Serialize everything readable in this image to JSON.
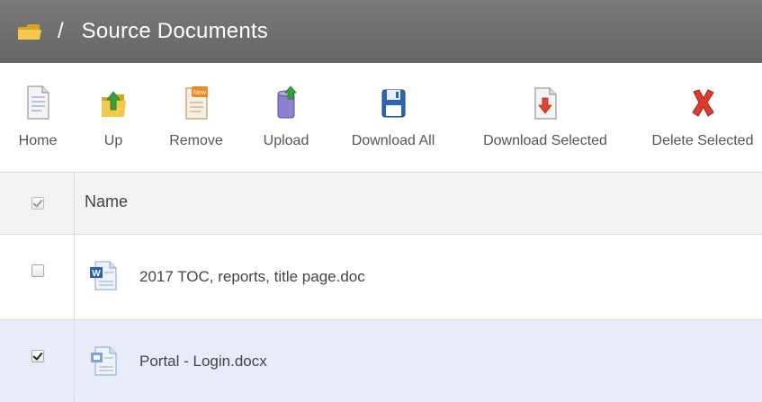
{
  "header": {
    "separator": "/",
    "title": "Source Documents",
    "icon": "folder-icon"
  },
  "toolbar": {
    "home": {
      "label": "Home",
      "icon": "document-icon"
    },
    "up": {
      "label": "Up",
      "icon": "folder-up-icon"
    },
    "remove": {
      "label": "Remove",
      "icon": "new-document-icon"
    },
    "upload": {
      "label": "Upload",
      "icon": "upload-icon"
    },
    "download_all": {
      "label": "Download All",
      "icon": "floppy-disk-icon"
    },
    "download_selected": {
      "label": "Download Selected",
      "icon": "download-document-icon"
    },
    "delete_selected": {
      "label": "Delete Selected",
      "icon": "red-x-icon"
    }
  },
  "table": {
    "header_name": "Name",
    "rows": [
      {
        "name": "2017 TOC, reports, title page.doc",
        "checked": false,
        "icon": "word-doc-icon"
      },
      {
        "name": "Portal - Login.docx",
        "checked": true,
        "icon": "word-docx-icon"
      }
    ]
  },
  "colors": {
    "header_bg": "#6e6e6e",
    "header_text": "#ffffff",
    "selected_row_bg": "#e8ecf8",
    "table_header_bg": "#f3f3f3",
    "delete_red": "#e03a2c"
  }
}
